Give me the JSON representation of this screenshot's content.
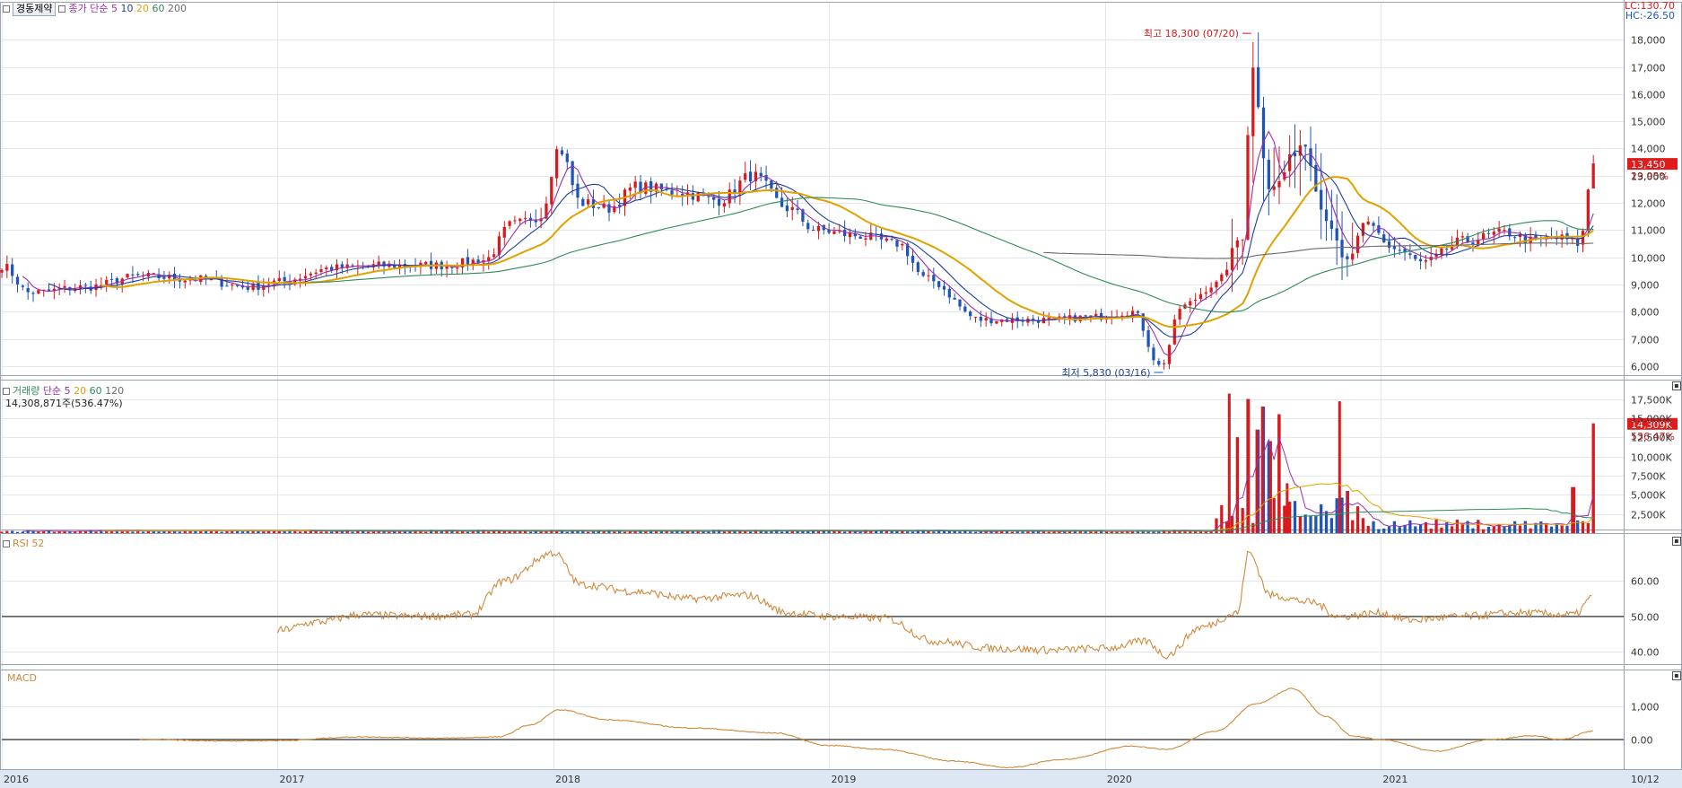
{
  "price_legend": {
    "stock_name": "경동제약",
    "ma_prefix": "종가 단순",
    "periods": [
      "5",
      "10",
      "20",
      "60",
      "200"
    ],
    "period_colors": [
      "#9b2fae",
      "#1f3f9f",
      "#e0a200",
      "#2e8b57",
      "#6b6b6b"
    ]
  },
  "volume_legend": {
    "label": "거래량",
    "ma_prefix": "단순",
    "periods": [
      "5",
      "20",
      "60",
      "120"
    ],
    "period_colors": [
      "#9b2fae",
      "#e0a200",
      "#2e8b57",
      "#6b6b6b"
    ],
    "current": "14,308,871주(536.47%)"
  },
  "rsi_legend": {
    "label": "RSI 52"
  },
  "macd_legend": {
    "label": "MACD"
  },
  "top_right": {
    "lc": "LC:130.70",
    "hc": "HC:-26.50"
  },
  "colors": {
    "up": "#d9191c",
    "down": "#1f55b8",
    "rsi_line": "#d2883a",
    "macd_line": "#d2883a"
  },
  "chart_data": [
    {
      "type": "candlestick",
      "title": "경동제약",
      "frequency": "weekly",
      "x_labels": [
        "2016",
        "2017",
        "2018",
        "2019",
        "2020",
        "2021",
        "10/12"
      ],
      "y_ticks": [
        "6,000",
        "7,000",
        "8,000",
        "9,000",
        "10,000",
        "11,000",
        "12,000",
        "13,000",
        "14,000",
        "15,000",
        "16,000",
        "17,000",
        "18,000"
      ],
      "ylim": [
        5500,
        18800
      ],
      "annotations": {
        "high": "최고 18,300 (07/20)",
        "low": "최저 5,830 (03/16)"
      },
      "last_price": "13,450",
      "last_change": "29.95%",
      "close_anchors": [
        [
          2016.0,
          9700
        ],
        [
          2016.1,
          8700
        ],
        [
          2016.3,
          8900
        ],
        [
          2016.5,
          9300
        ],
        [
          2016.7,
          9200
        ],
        [
          2016.9,
          8900
        ],
        [
          2017.0,
          9100
        ],
        [
          2017.2,
          9600
        ],
        [
          2017.4,
          9700
        ],
        [
          2017.6,
          9700
        ],
        [
          2017.75,
          9900
        ],
        [
          2017.85,
          11200
        ],
        [
          2017.95,
          11500
        ],
        [
          2018.02,
          14000
        ],
        [
          2018.1,
          12000
        ],
        [
          2018.2,
          11800
        ],
        [
          2018.3,
          12600
        ],
        [
          2018.45,
          12400
        ],
        [
          2018.6,
          12100
        ],
        [
          2018.72,
          13000
        ],
        [
          2018.85,
          11800
        ],
        [
          2018.95,
          11000
        ],
        [
          2019.1,
          10800
        ],
        [
          2019.25,
          10500
        ],
        [
          2019.35,
          9200
        ],
        [
          2019.55,
          7700
        ],
        [
          2019.8,
          7700
        ],
        [
          2019.95,
          7800
        ],
        [
          2020.1,
          8000
        ],
        [
          2020.2,
          6000
        ],
        [
          2020.28,
          8200
        ],
        [
          2020.4,
          9000
        ],
        [
          2020.5,
          10800
        ],
        [
          2020.53,
          17000
        ],
        [
          2020.6,
          12500
        ],
        [
          2020.72,
          14200
        ],
        [
          2020.8,
          11500
        ],
        [
          2020.87,
          9800
        ],
        [
          2020.95,
          11200
        ],
        [
          2021.05,
          10300
        ],
        [
          2021.15,
          9800
        ],
        [
          2021.3,
          10600
        ],
        [
          2021.45,
          10900
        ],
        [
          2021.55,
          10600
        ],
        [
          2021.65,
          10700
        ],
        [
          2021.72,
          10500
        ],
        [
          2021.77,
          13450
        ]
      ],
      "moving_average_periods": [
        5,
        10,
        20,
        60,
        200
      ]
    },
    {
      "type": "bar",
      "title": "거래량",
      "y_ticks": [
        "2,500K",
        "5,000K",
        "7,500K",
        "10,000K",
        "12,500K",
        "15,000K",
        "17,500K"
      ],
      "ylim": [
        0,
        18500
      ],
      "unit": "K",
      "last_value": "14,309K",
      "last_change": "536.47%",
      "spikes": [
        [
          2020.45,
          18200
        ],
        [
          2020.48,
          12500
        ],
        [
          2020.52,
          17500
        ],
        [
          2020.55,
          13500
        ],
        [
          2020.57,
          16500
        ],
        [
          2020.6,
          12000
        ],
        [
          2020.63,
          15500
        ],
        [
          2020.66,
          6500
        ],
        [
          2020.85,
          17200
        ],
        [
          2020.88,
          5500
        ],
        [
          2021.7,
          6000
        ],
        [
          2021.77,
          14309
        ]
      ]
    },
    {
      "type": "line",
      "title": "RSI 52",
      "y_ticks": [
        "40.00",
        "50.00",
        "60.00"
      ],
      "ylim": [
        35,
        70
      ],
      "reference_line": 50,
      "anchors": [
        [
          2017.0,
          46
        ],
        [
          2017.15,
          48.5
        ],
        [
          2017.3,
          50.5
        ],
        [
          2017.5,
          50
        ],
        [
          2017.7,
          50.5
        ],
        [
          2017.82,
          60
        ],
        [
          2018.0,
          68
        ],
        [
          2018.1,
          59
        ],
        [
          2018.3,
          57
        ],
        [
          2018.5,
          55
        ],
        [
          2018.7,
          56
        ],
        [
          2018.85,
          51
        ],
        [
          2019.0,
          50
        ],
        [
          2019.2,
          49.5
        ],
        [
          2019.38,
          43
        ],
        [
          2019.6,
          41
        ],
        [
          2019.8,
          40.5
        ],
        [
          2020.0,
          41
        ],
        [
          2020.15,
          43
        ],
        [
          2020.22,
          39
        ],
        [
          2020.35,
          47
        ],
        [
          2020.48,
          51
        ],
        [
          2020.52,
          68
        ],
        [
          2020.6,
          56
        ],
        [
          2020.75,
          54
        ],
        [
          2020.85,
          50
        ],
        [
          2021.0,
          51
        ],
        [
          2021.1,
          49
        ],
        [
          2021.3,
          50
        ],
        [
          2021.5,
          51
        ],
        [
          2021.7,
          50.5
        ],
        [
          2021.77,
          55.5
        ]
      ]
    },
    {
      "type": "line",
      "title": "MACD",
      "y_ticks": [
        "0.00",
        "1,000"
      ],
      "ylim": [
        -900,
        1800
      ],
      "reference_line": 0,
      "anchors": [
        [
          2016.5,
          0
        ],
        [
          2016.8,
          -40
        ],
        [
          2017.0,
          -30
        ],
        [
          2017.3,
          80
        ],
        [
          2017.6,
          40
        ],
        [
          2017.8,
          80
        ],
        [
          2017.92,
          450
        ],
        [
          2018.02,
          900
        ],
        [
          2018.2,
          600
        ],
        [
          2018.5,
          350
        ],
        [
          2018.8,
          200
        ],
        [
          2019.0,
          -180
        ],
        [
          2019.2,
          -300
        ],
        [
          2019.45,
          -650
        ],
        [
          2019.65,
          -850
        ],
        [
          2019.85,
          -600
        ],
        [
          2020.1,
          -200
        ],
        [
          2020.22,
          -300
        ],
        [
          2020.4,
          250
        ],
        [
          2020.55,
          1100
        ],
        [
          2020.68,
          1550
        ],
        [
          2020.8,
          700
        ],
        [
          2020.9,
          100
        ],
        [
          2021.0,
          0
        ],
        [
          2021.2,
          -350
        ],
        [
          2021.4,
          0
        ],
        [
          2021.55,
          120
        ],
        [
          2021.65,
          0
        ],
        [
          2021.77,
          250
        ]
      ]
    }
  ]
}
